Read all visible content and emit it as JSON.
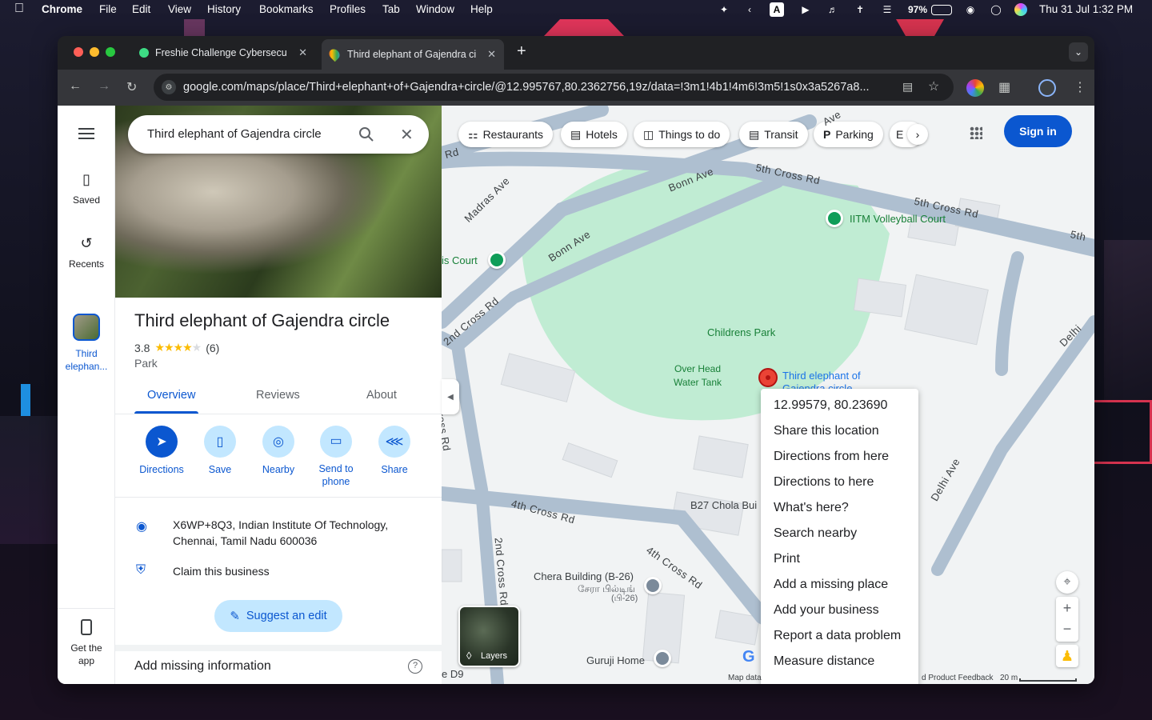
{
  "menubar": {
    "app": "Chrome",
    "menus": [
      "File",
      "Edit",
      "View",
      "History",
      "Bookmarks",
      "Profiles",
      "Tab",
      "Window",
      "Help"
    ],
    "battery": "97%",
    "datetime": "Thu 31 Jul  1:32 PM",
    "keyboard": "A"
  },
  "browser": {
    "tabs": [
      {
        "title": "Freshie Challenge Cybersecu"
      },
      {
        "title": "Third elephant of Gajendra ci"
      }
    ],
    "url": "google.com/maps/place/Third+elephant+of+Gajendra+circle/@12.995767,80.2362756,19z/data=!3m1!4b1!4m6!3m5!1s0x3a5267a8..."
  },
  "rail": {
    "items": [
      {
        "label": "Saved"
      },
      {
        "label": "Recents"
      },
      {
        "label": "Third elephan..."
      },
      {
        "label": "Get the app"
      }
    ]
  },
  "place": {
    "search_query": "Third elephant of Gajendra circle",
    "title": "Third elephant of Gajendra circle",
    "rating": "3.8",
    "stars": 3.8,
    "reviews": "(6)",
    "category": "Park",
    "tabs": [
      "Overview",
      "Reviews",
      "About"
    ],
    "actions": [
      {
        "label": "Directions"
      },
      {
        "label": "Save"
      },
      {
        "label": "Nearby"
      },
      {
        "label": "Send to phone"
      },
      {
        "label": "Share"
      }
    ],
    "address_line1": "X6WP+8Q3, Indian Institute Of Technology,",
    "address_line2": "Chennai, Tamil Nadu 600036",
    "claim": "Claim this business",
    "suggest": "Suggest an edit",
    "add_missing": "Add missing information"
  },
  "map": {
    "chips": [
      "Restaurants",
      "Hotels",
      "Things to do",
      "Transit",
      "Parking",
      "E"
    ],
    "sign_in": "Sign in",
    "roads": [
      "Madras Ave",
      "Bonn Ave",
      "Bonn Ave",
      "5th Cross Rd",
      "5th Cross Rd",
      "5th",
      "Bonn Ave",
      "2nd Cross Rd",
      "2nd Cross Rd",
      "4th Cross Rd",
      "4th Cross Rd",
      "Delhi Ave",
      "Delhi",
      "Rd",
      "Ave"
    ],
    "places": {
      "volleyball": "IITM Volleyball Court",
      "court": "is Court",
      "park": "Childrens Park",
      "tank": "Over Head Water Tank",
      "pin": "Third elephant of Gajendra circle",
      "b27": "B27 Chola Bui",
      "chera": "Chera Building (B-26)",
      "chera_ta": "சேரா பில்டிங்",
      "chera_ta2": "(பி-26)",
      "guruji": "Guruji Home",
      "d9": "e D9"
    },
    "context_menu": [
      "12.99579, 80.23690",
      "Share this location",
      "Directions from here",
      "Directions to here",
      "What's here?",
      "Search nearby",
      "Print",
      "Add a missing place",
      "Add your business",
      "Report a data problem",
      "Measure distance"
    ],
    "layers": "Layers",
    "footer_left": "Map data",
    "footer_feedback": "d Product Feedback",
    "scale": "20 m"
  },
  "colors": {
    "accent": "#0b57d0",
    "chip_bg": "#c2e7ff",
    "park": "#c0ecd3",
    "pin": "#ea4335",
    "poi": "#0f9d58"
  }
}
